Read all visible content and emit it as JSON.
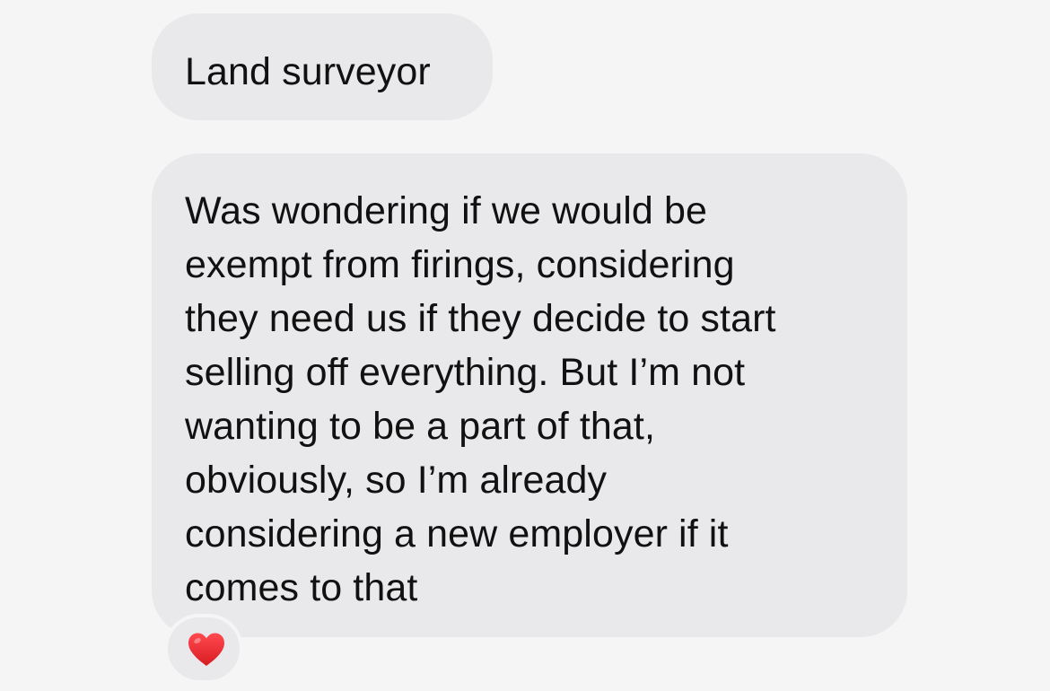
{
  "messages": [
    {
      "lines": [
        "Land surveyor"
      ]
    },
    {
      "lines": [
        "Was wondering if we would be",
        "exempt from firings, considering",
        "they need us if they decide to start",
        "selling off everything. But I’m not",
        "wanting to be a part of that,",
        "obviously, so I’m already",
        "considering a new employer if it",
        "comes to that"
      ]
    }
  ],
  "reaction": {
    "icon": "heart-icon",
    "color": "#e8262b"
  },
  "colors": {
    "background": "#f5f5f5",
    "bubble": "#e9e9eb",
    "text": "#111111"
  }
}
